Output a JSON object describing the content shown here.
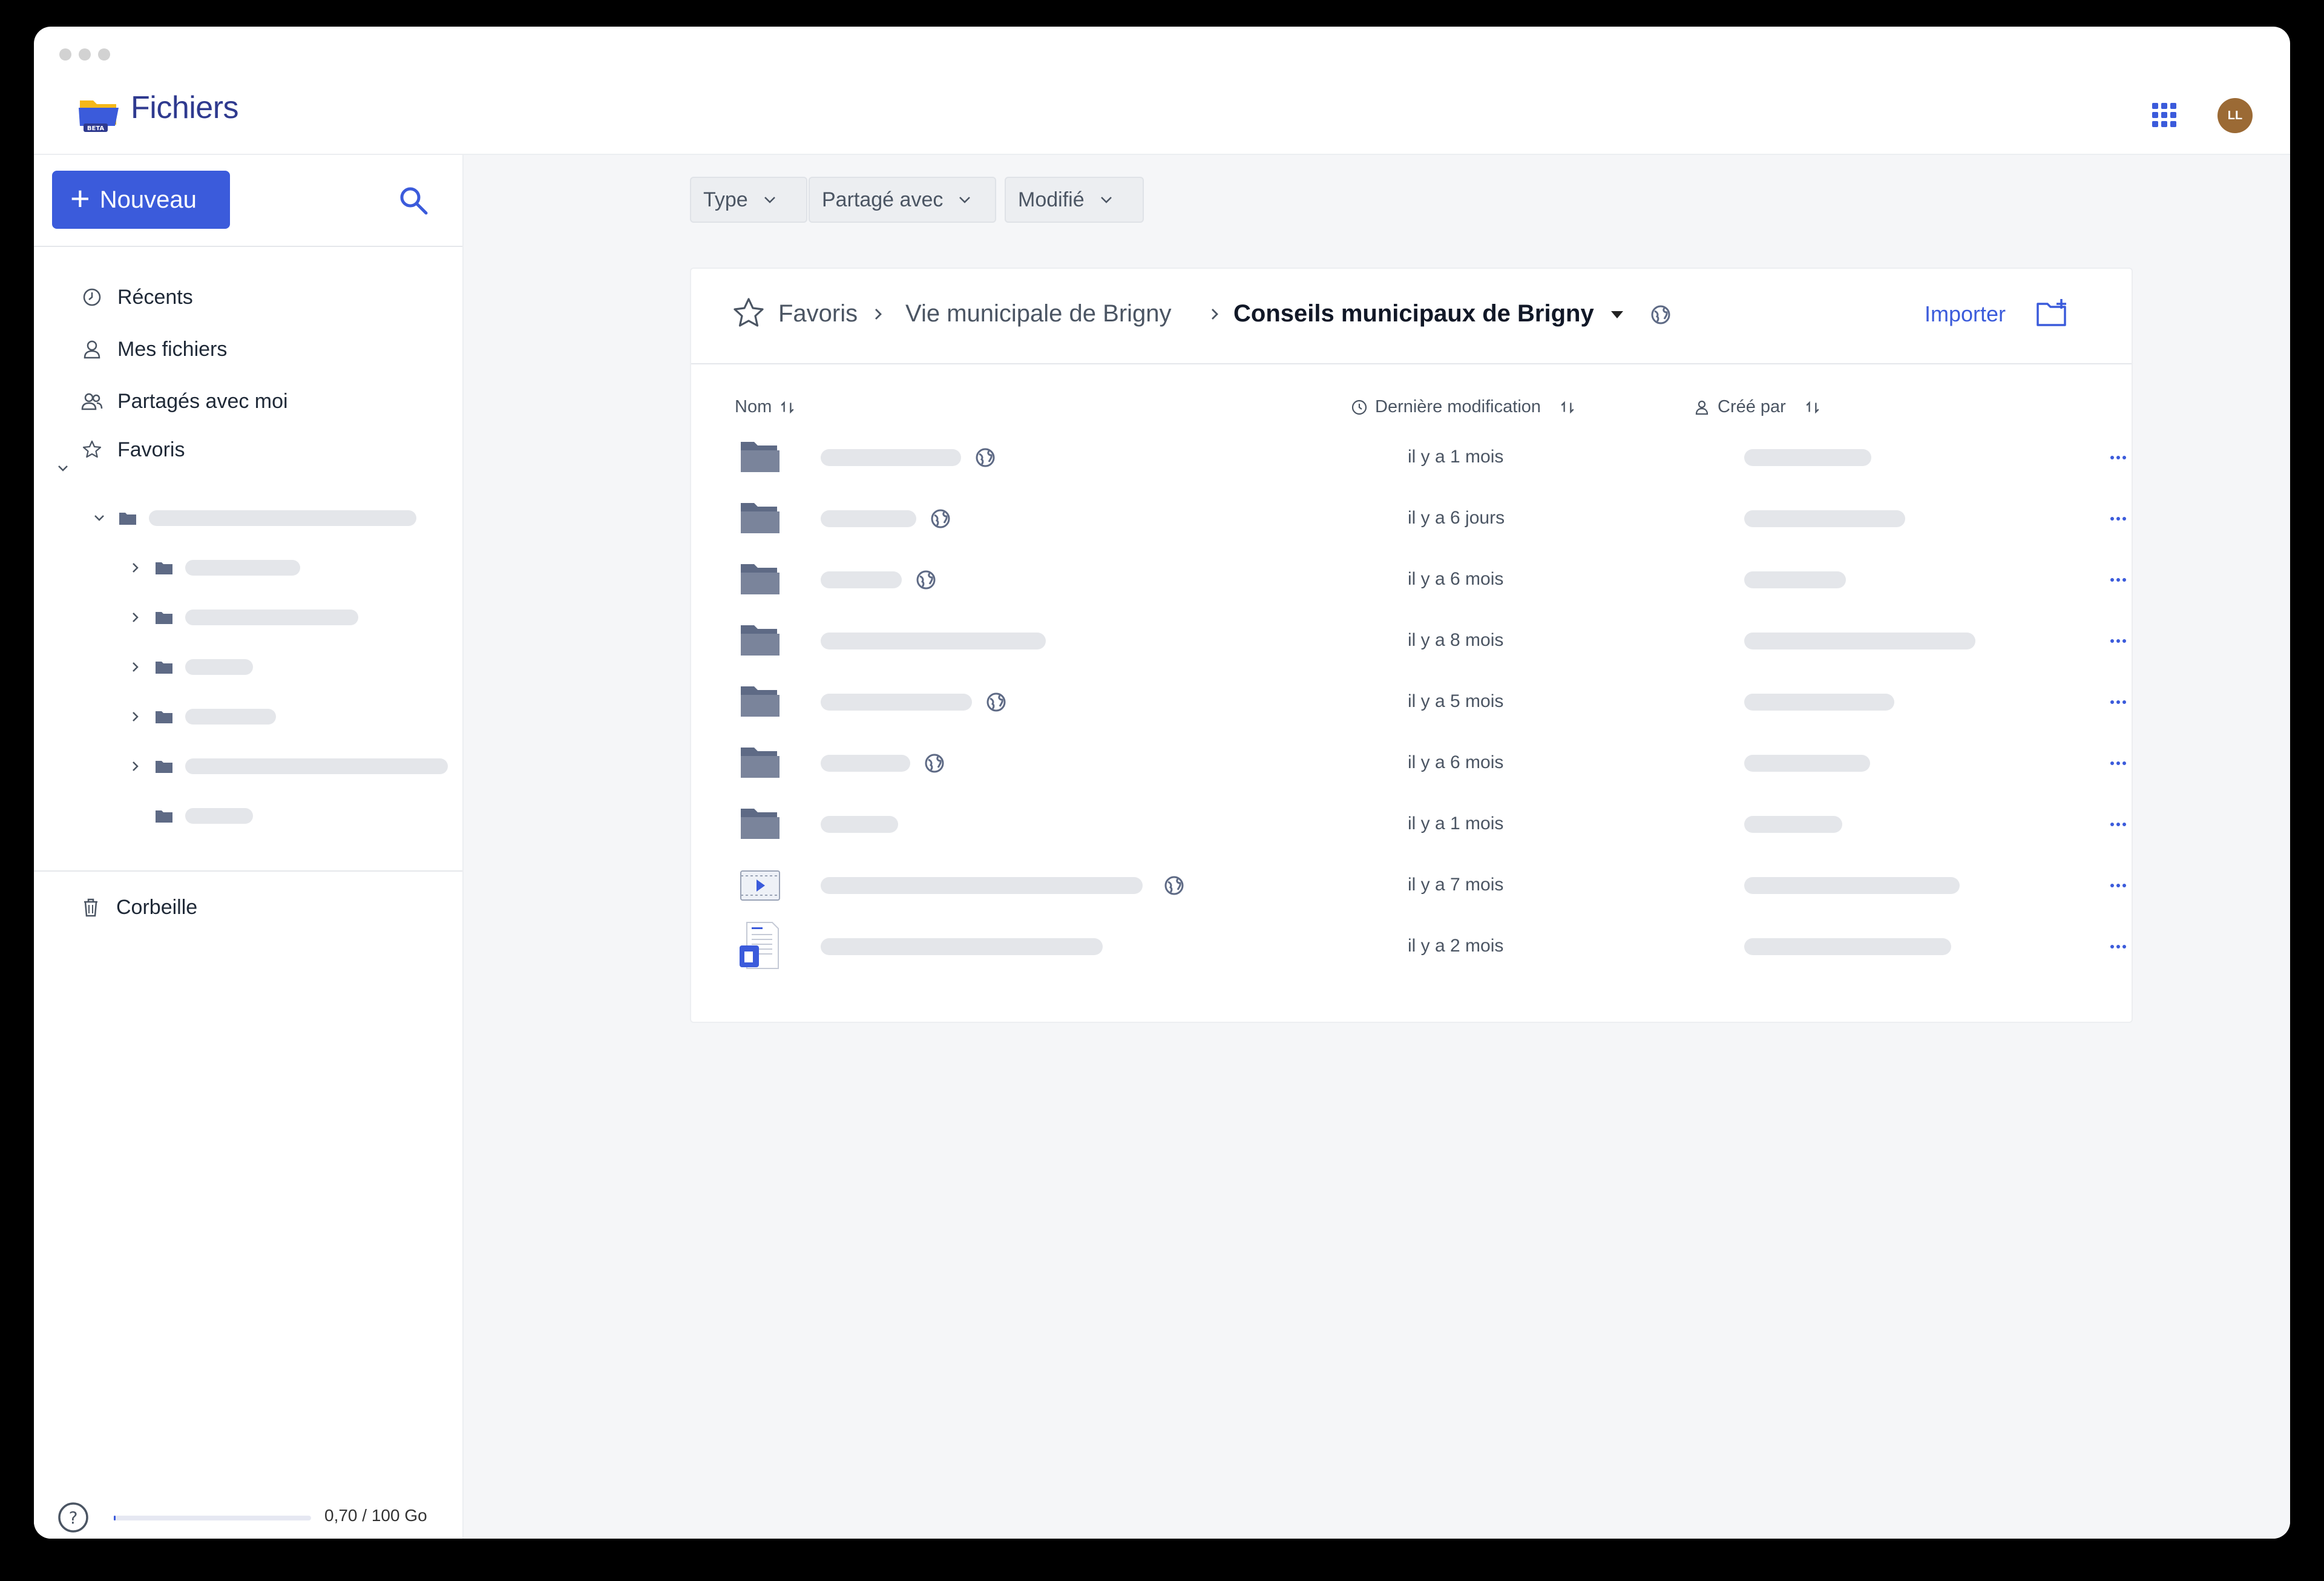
{
  "app": {
    "title": "Fichiers",
    "badge": "BETA",
    "user_initials": "LL",
    "brand_color": "#3b5bdb"
  },
  "sidebar": {
    "new_button": "Nouveau",
    "nav": [
      {
        "label": "Récents",
        "icon": "clock-icon"
      },
      {
        "label": "Mes fichiers",
        "icon": "user-icon"
      },
      {
        "label": "Partagés avec moi",
        "icon": "users-icon"
      },
      {
        "label": "Favoris",
        "icon": "star-icon"
      }
    ],
    "trash": "Corbeille",
    "storage": {
      "text": "0,70 / 100 Go",
      "used_fraction": 0.007
    }
  },
  "filters": [
    {
      "label": "Type"
    },
    {
      "label": "Partagé avec"
    },
    {
      "label": "Modifié"
    }
  ],
  "breadcrumb": {
    "items": [
      "Favoris",
      "Vie municipale de Brigny",
      "Conseils municipaux de Brigny"
    ],
    "import_label": "Importer"
  },
  "table": {
    "columns": {
      "name": "Nom",
      "modified": "Dernière modification",
      "created_by": "Créé par"
    },
    "rows": [
      {
        "type": "folder",
        "public": true,
        "modified": "il y a 1 mois"
      },
      {
        "type": "folder",
        "public": true,
        "modified": "il y a 6 jours"
      },
      {
        "type": "folder",
        "public": true,
        "modified": "il y a 6 mois"
      },
      {
        "type": "folder",
        "public": false,
        "modified": "il y a 8 mois"
      },
      {
        "type": "folder",
        "public": true,
        "modified": "il y a 5 mois"
      },
      {
        "type": "folder",
        "public": true,
        "modified": "il y a 6 mois"
      },
      {
        "type": "folder",
        "public": false,
        "modified": "il y a 1 mois"
      },
      {
        "type": "video",
        "public": true,
        "modified": "il y a 7 mois"
      },
      {
        "type": "document",
        "public": false,
        "modified": "il y a 2 mois"
      }
    ]
  }
}
